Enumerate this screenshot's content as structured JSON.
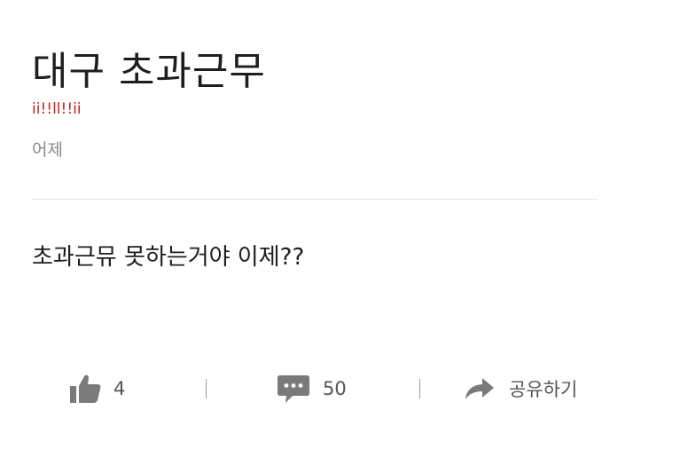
{
  "post": {
    "title": "대구 초과근무",
    "author": "ii!!ll!!ii",
    "date": "어제",
    "body": "초과근뮤 못하는거야 이제??"
  },
  "actions": {
    "like_count": "4",
    "comment_count": "50",
    "share_label": "공유하기"
  },
  "icons": {
    "like": "thumbs-up-icon",
    "comment": "speech-bubble-icon",
    "share": "share-arrow-icon"
  },
  "colors": {
    "author": "#c0282a",
    "icon": "#7a7a7a"
  }
}
